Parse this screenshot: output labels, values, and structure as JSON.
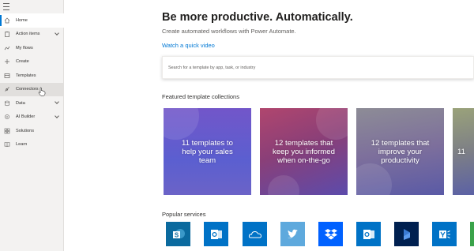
{
  "sidebar": {
    "items": [
      {
        "label": "Home",
        "icon": "home-icon",
        "active": true
      },
      {
        "label": "Action items",
        "icon": "clipboard-icon",
        "expandable": true
      },
      {
        "label": "My flows",
        "icon": "flow-icon"
      },
      {
        "label": "Create",
        "icon": "plus-icon"
      },
      {
        "label": "Templates",
        "icon": "templates-icon"
      },
      {
        "label": "Connectors",
        "icon": "connectors-icon",
        "hover": true
      },
      {
        "label": "Data",
        "icon": "database-icon",
        "expandable": true
      },
      {
        "label": "AI Builder",
        "icon": "ai-builder-icon",
        "expandable": true
      },
      {
        "label": "Solutions",
        "icon": "solutions-icon"
      },
      {
        "label": "Learn",
        "icon": "book-icon"
      }
    ]
  },
  "main": {
    "title": "Be more productive. Automatically.",
    "subtitle": "Create automated workflows with Power Automate.",
    "video_link": "Watch a quick video",
    "search_placeholder": "Search for a template by app, task, or industry",
    "featured_title": "Featured template collections",
    "cards": [
      {
        "text": "11 templates to help your sales team"
      },
      {
        "text": "12 templates that keep you informed when on-the-go"
      },
      {
        "text": "12 templates that improve your productivity"
      },
      {
        "text": "11"
      }
    ],
    "popular_title": "Popular services",
    "services": [
      {
        "name": "SharePoint",
        "icon": "sharepoint-icon",
        "color": "#0b6a9e"
      },
      {
        "name": "Office 365 Outlook",
        "icon": "outlook-icon",
        "color": "#0072c6"
      },
      {
        "name": "OneDrive",
        "icon": "onedrive-icon",
        "color": "#0072c6"
      },
      {
        "name": "Twitter",
        "icon": "twitter-icon",
        "color": "#5ea9dd"
      },
      {
        "name": "Dropbox",
        "icon": "dropbox-icon",
        "color": "#0061ff"
      },
      {
        "name": "Outlook.com",
        "icon": "outlook-com-icon",
        "color": "#0072c6"
      },
      {
        "name": "Dynamics 365",
        "icon": "dynamics-icon",
        "color": "#002050"
      },
      {
        "name": "Yammer",
        "icon": "yammer-icon",
        "color": "#0072c6"
      }
    ]
  },
  "colors": {
    "accent": "#0078d4",
    "sidebar_bg": "#f3f2f1"
  }
}
